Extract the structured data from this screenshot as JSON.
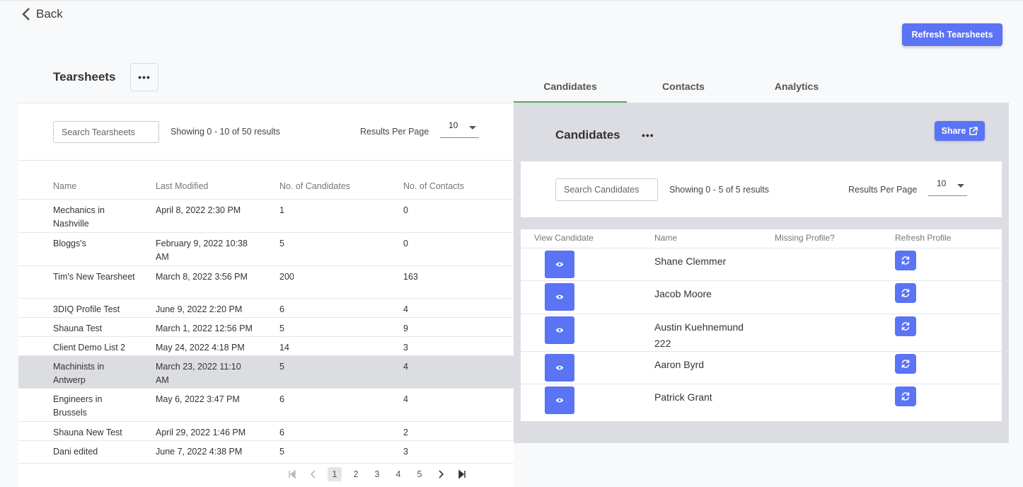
{
  "nav": {
    "back_label": "Back"
  },
  "header": {
    "refresh_tearsheets_label": "Refresh Tearsheets"
  },
  "tearsheets": {
    "title": "Tearsheets",
    "more_label": "•••",
    "search_placeholder": "Search Tearsheets",
    "showing": "Showing 0 - 10 of 50 results",
    "results_per_page_label": "Results Per Page",
    "results_per_page_value": "10",
    "columns": [
      "Name",
      "Last Modified",
      "No. of Candidates",
      "No. of Contacts"
    ],
    "rows": [
      {
        "name": "Mechanics in Nashville",
        "modified": "April 8, 2022 2:30 PM",
        "candidates": "1",
        "contacts": "0"
      },
      {
        "name": "Bloggs's",
        "modified": "February 9, 2022 10:38 AM",
        "candidates": "5",
        "contacts": "0"
      },
      {
        "name": "Tim's New Tearsheet",
        "modified": "March 8, 2022 3:56 PM",
        "candidates": "200",
        "contacts": "163"
      },
      {
        "name": "3DIQ Profile Test",
        "modified": "June 9, 2022 2:20 PM",
        "candidates": "6",
        "contacts": "4"
      },
      {
        "name": "Shauna Test",
        "modified": "March 1, 2022 12:56 PM",
        "candidates": "5",
        "contacts": "9"
      },
      {
        "name": "Client Demo List 2",
        "modified": "May 24, 2022 4:18 PM",
        "candidates": "14",
        "contacts": "3"
      },
      {
        "name": "Machinists in Antwerp",
        "modified": "March 23, 2022 11:10 AM",
        "candidates": "5",
        "contacts": "4"
      },
      {
        "name": "Engineers in Brussels",
        "modified": "May 6, 2022 3:47 PM",
        "candidates": "6",
        "contacts": "4"
      },
      {
        "name": "Shauna New Test",
        "modified": "April 29, 2022 1:46 PM",
        "candidates": "6",
        "contacts": "2"
      },
      {
        "name": "Dani edited",
        "modified": "June 7, 2022 4:38 PM",
        "candidates": "5",
        "contacts": "3"
      }
    ],
    "selected_row": 6,
    "pagination": {
      "pages": [
        "1",
        "2",
        "3",
        "4",
        "5"
      ],
      "current": "1"
    }
  },
  "tabs": [
    {
      "label": "Candidates",
      "active": true
    },
    {
      "label": "Contacts",
      "active": false
    },
    {
      "label": "Analytics",
      "active": false
    }
  ],
  "candidates": {
    "title": "Candidates",
    "more_label": "•••",
    "share_label": "Share",
    "search_placeholder": "Search Candidates",
    "showing": "Showing 0 - 5 of 5 results",
    "results_per_page_label": "Results Per Page",
    "results_per_page_value": "10",
    "columns": [
      "View Candidate",
      "Name",
      "Missing Profile?",
      "Refresh Profile"
    ],
    "rows": [
      {
        "name": "Shane Clemmer",
        "missing": ""
      },
      {
        "name": "Jacob Moore",
        "missing": ""
      },
      {
        "name": "Austin Kuehnemund 222",
        "missing": ""
      },
      {
        "name": "Aaron Byrd",
        "missing": ""
      },
      {
        "name": "Patrick Grant",
        "missing": ""
      }
    ]
  },
  "colors": {
    "accent": "#5b73f5",
    "tab_active": "#4caf50",
    "selected_row": "#dcdde1",
    "panel_bg": "#dcdde2"
  },
  "icons": {
    "back": "chevron-left-icon",
    "view": "eye-icon",
    "refresh": "refresh-icon",
    "share": "external-link-icon"
  }
}
